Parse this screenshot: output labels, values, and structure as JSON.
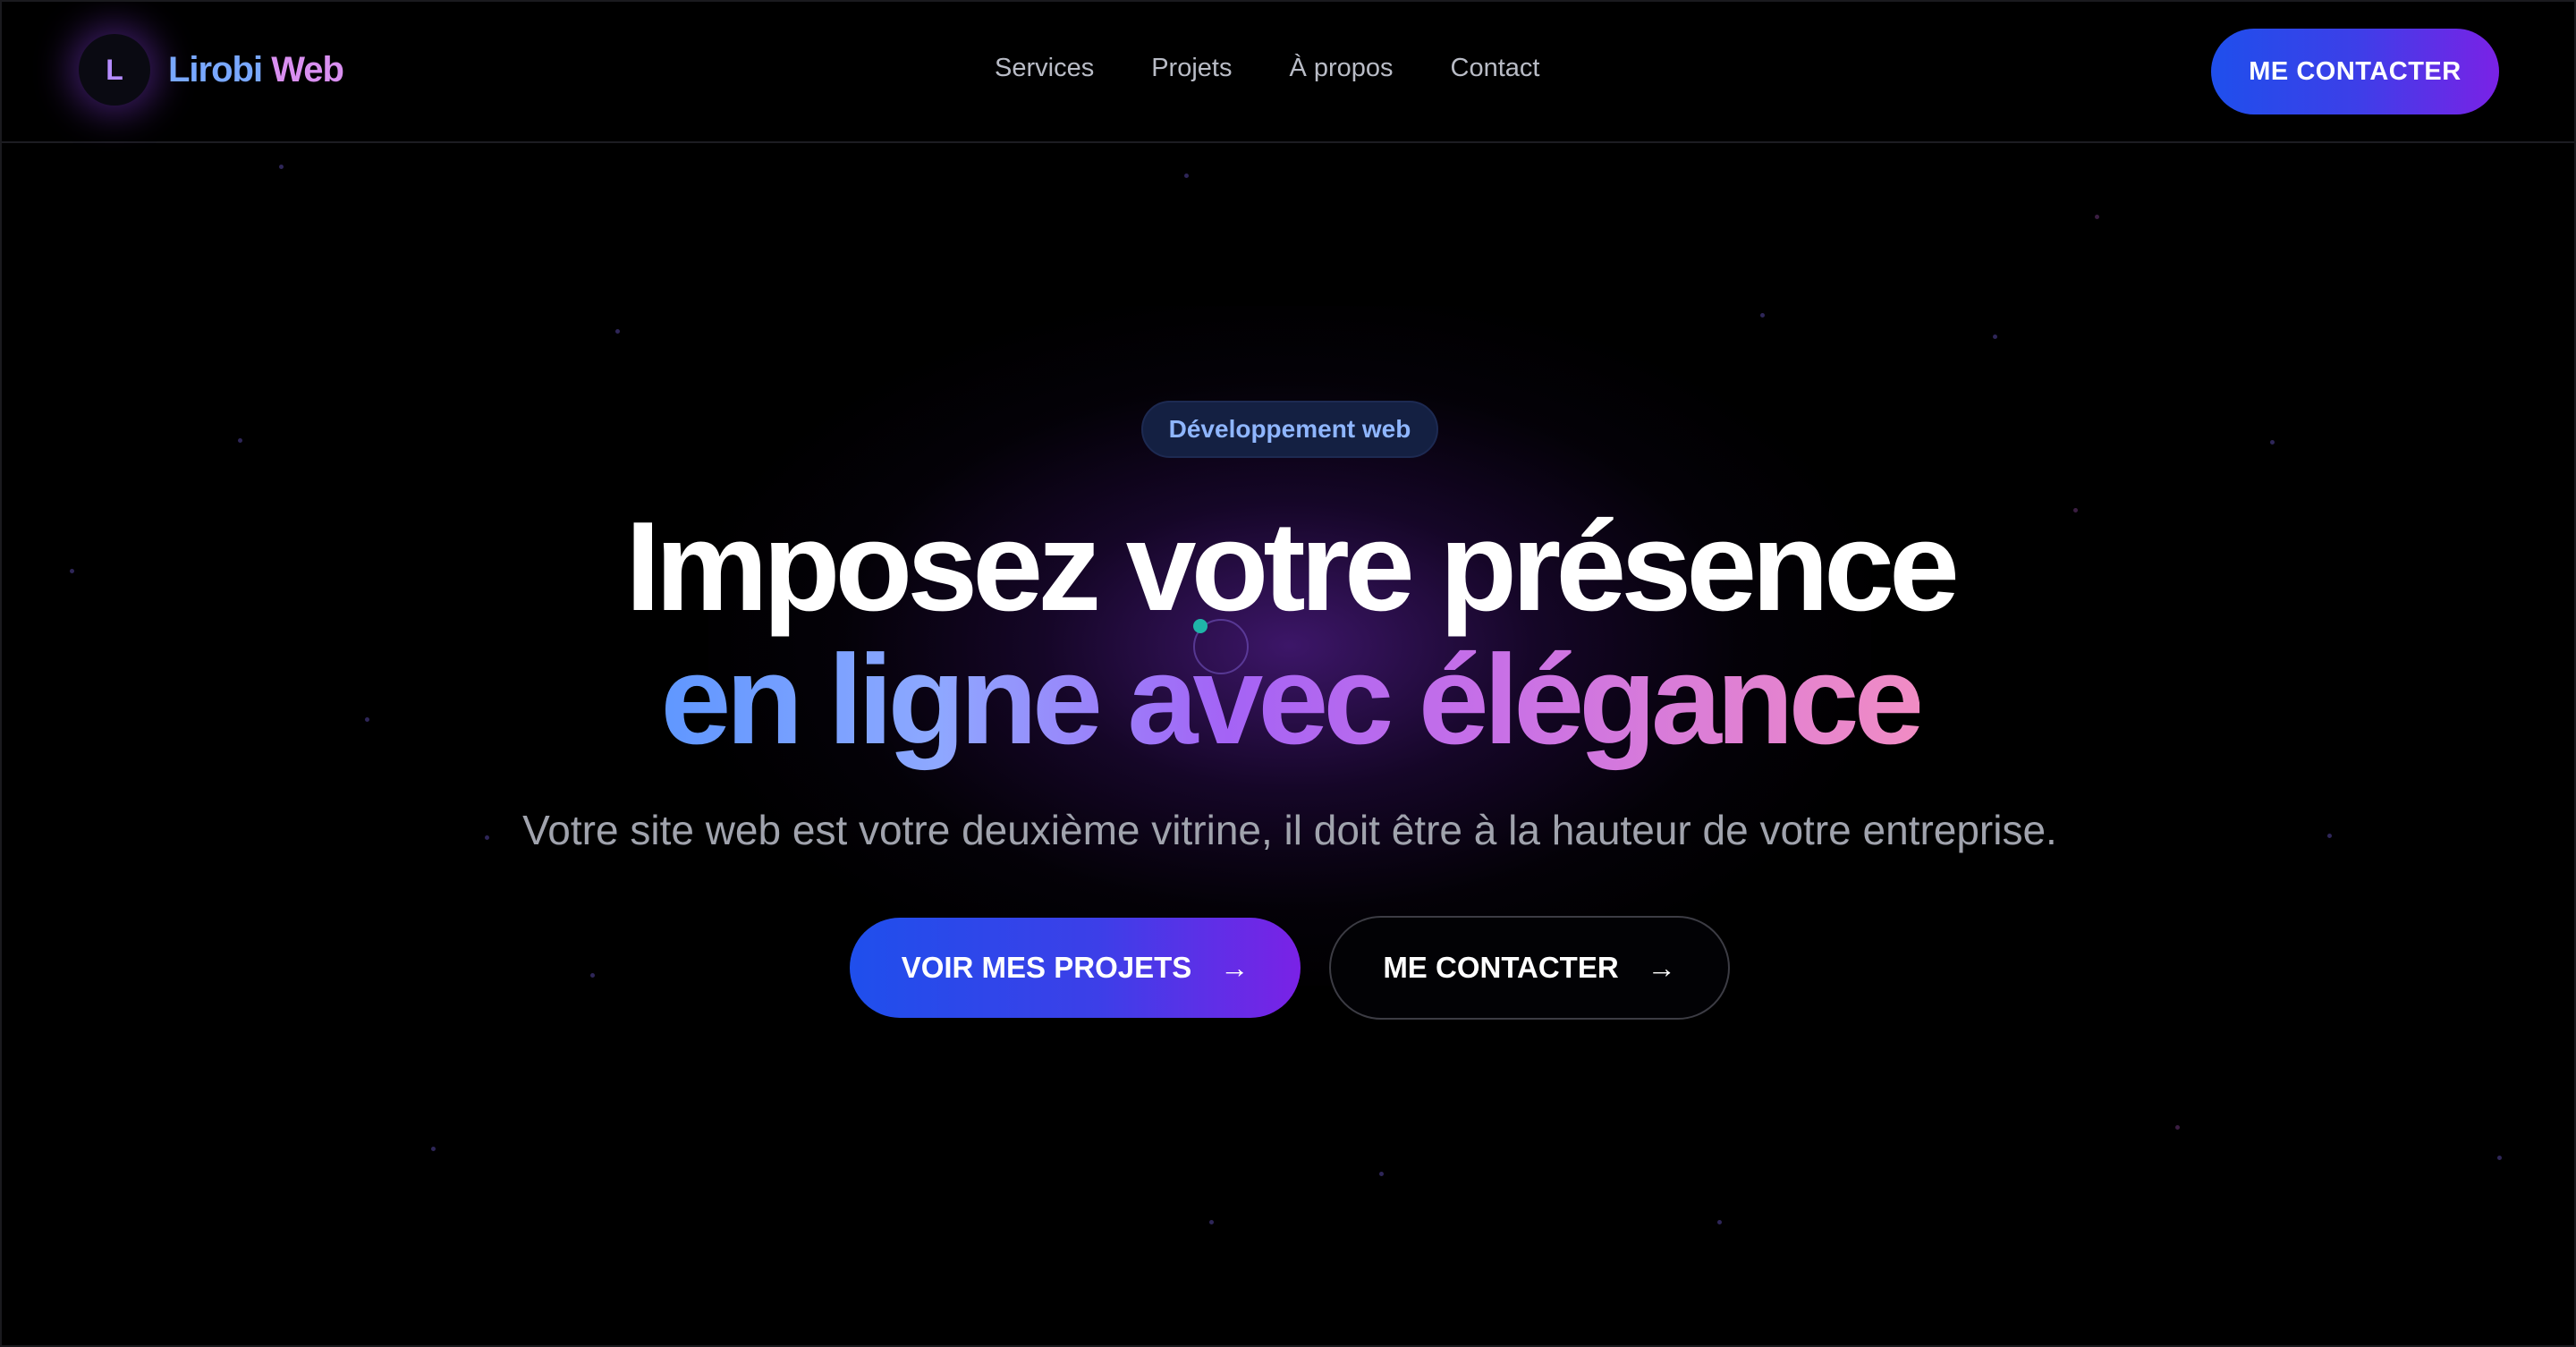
{
  "brand": {
    "initial": "L",
    "name_part1": "Lirobi",
    "name_part2": "Web"
  },
  "nav": {
    "items": [
      {
        "label": "Services"
      },
      {
        "label": "Projets"
      },
      {
        "label": "À propos"
      },
      {
        "label": "Contact"
      }
    ]
  },
  "header": {
    "cta_label": "ME CONTACTER"
  },
  "hero": {
    "badge": "Développement web",
    "title_line1": "Imposez votre présence",
    "title_line2": "en ligne avec élégance",
    "subtitle": "Votre site web est votre deuxième vitrine, il doit être à la hauteur de votre entreprise.",
    "primary_button": "VOIR MES PROJETS",
    "secondary_button": "ME CONTACTER",
    "arrow_glyph": "→"
  },
  "colors": {
    "accent_blue": "#1f4fec",
    "accent_purple": "#7a22e6",
    "gradient_start": "#5f97ff",
    "gradient_end": "#f18cc4",
    "background": "#000000"
  },
  "icons": {
    "arrow": "arrow-right-icon"
  }
}
